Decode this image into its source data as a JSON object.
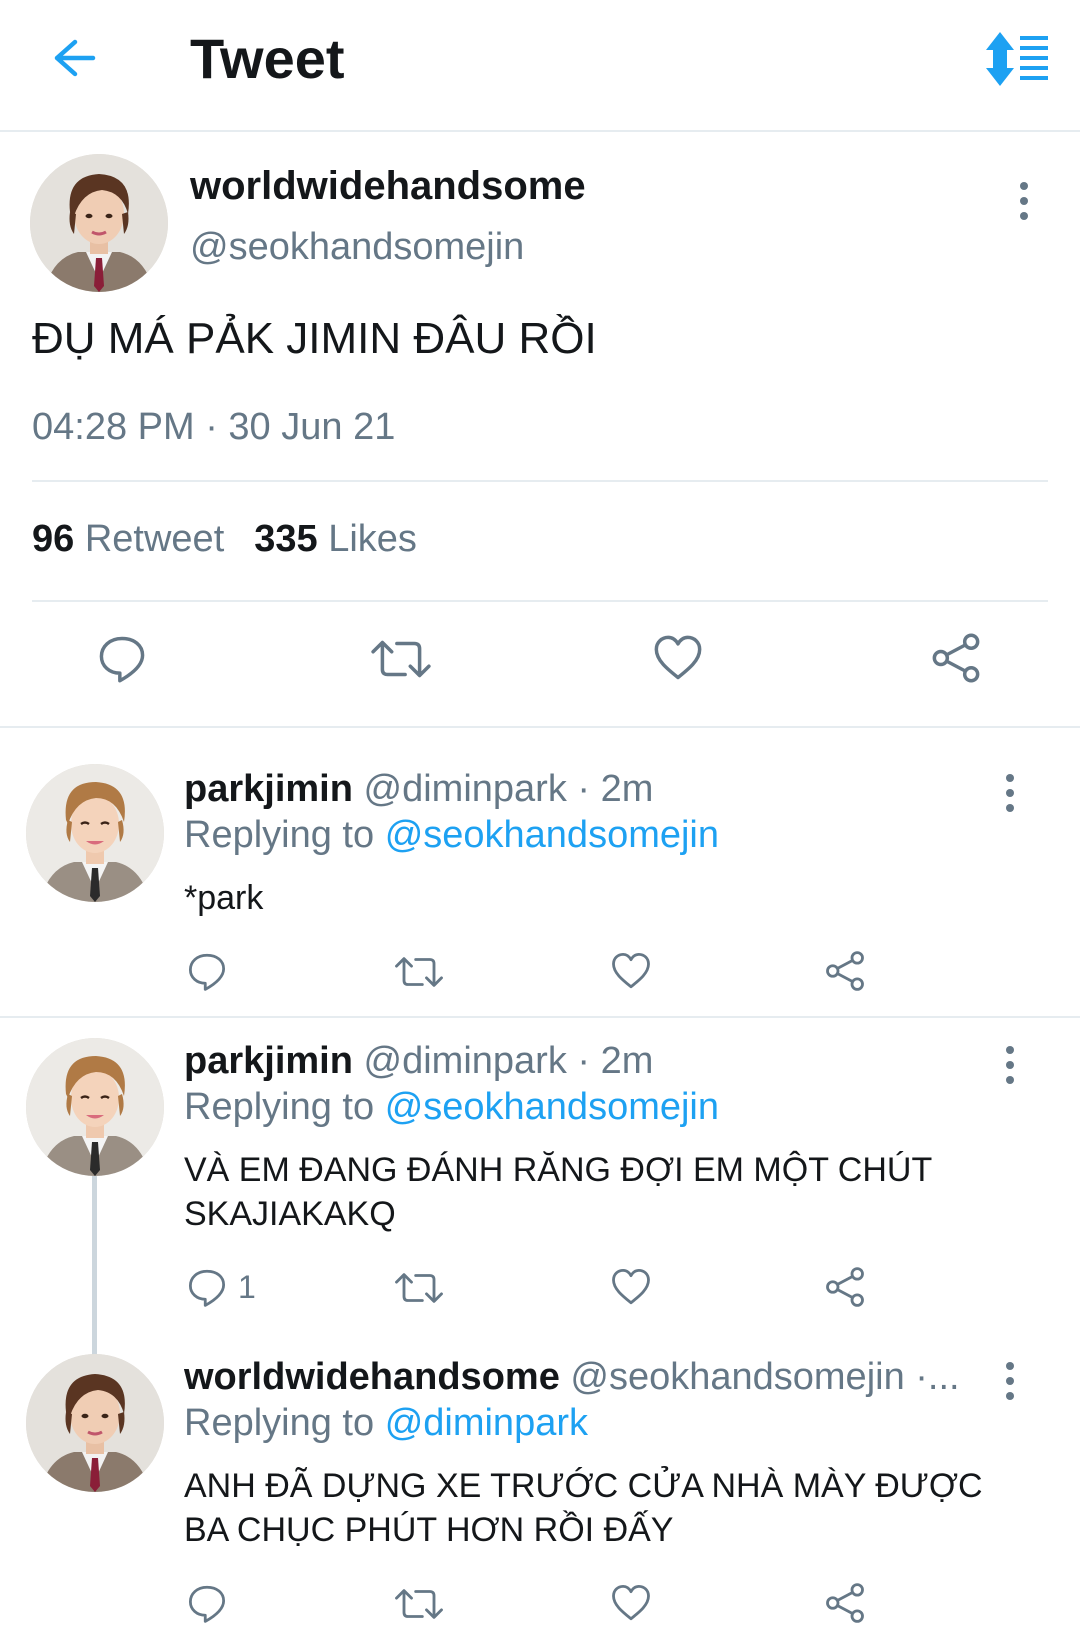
{
  "header": {
    "title": "Tweet",
    "back_icon": "arrow-left-icon",
    "sort_icon": "sort-icon",
    "accent": "#1da1f2"
  },
  "main_tweet": {
    "name": "worldwidehandsome",
    "handle": "@seokhandsomejin",
    "text": "ĐỤ MÁ PẢK JIMIN ĐÂU RỒI",
    "timestamp": "04:28 PM · 30 Jun 21",
    "retweet_count": "96",
    "retweet_label": "Retweet",
    "likes_count": "335",
    "likes_label": "Likes"
  },
  "replies": [
    {
      "name": "parkjimin",
      "handle_time": "@diminpark · 2m",
      "replying_label": "Replying to",
      "replying_to": "@seokhandsomejin",
      "text": "*park",
      "reply_count": ""
    },
    {
      "name": "parkjimin",
      "handle_time": "@diminpark · 2m",
      "replying_label": "Replying to",
      "replying_to": "@seokhandsomejin",
      "text": "VÀ EM ĐANG ĐÁNH RĂNG ĐỢI EM MỘT CHÚT SKAJIAKAKQ",
      "reply_count": "1"
    },
    {
      "name": "worldwidehandsome",
      "handle_time": "@seokhandsomejin ·...",
      "replying_label": "Replying to",
      "replying_to": "@diminpark",
      "text": "ANH ĐÃ DỰNG XE TRƯỚC CỬA NHÀ MÀY ĐƯỢC BA CHỤC PHÚT HƠN RỒI ĐẤY",
      "reply_count": ""
    }
  ],
  "icons": {
    "reply": "reply-icon",
    "retweet": "retweet-icon",
    "like": "heart-icon",
    "share": "share-icon",
    "more": "more-vertical-icon"
  }
}
